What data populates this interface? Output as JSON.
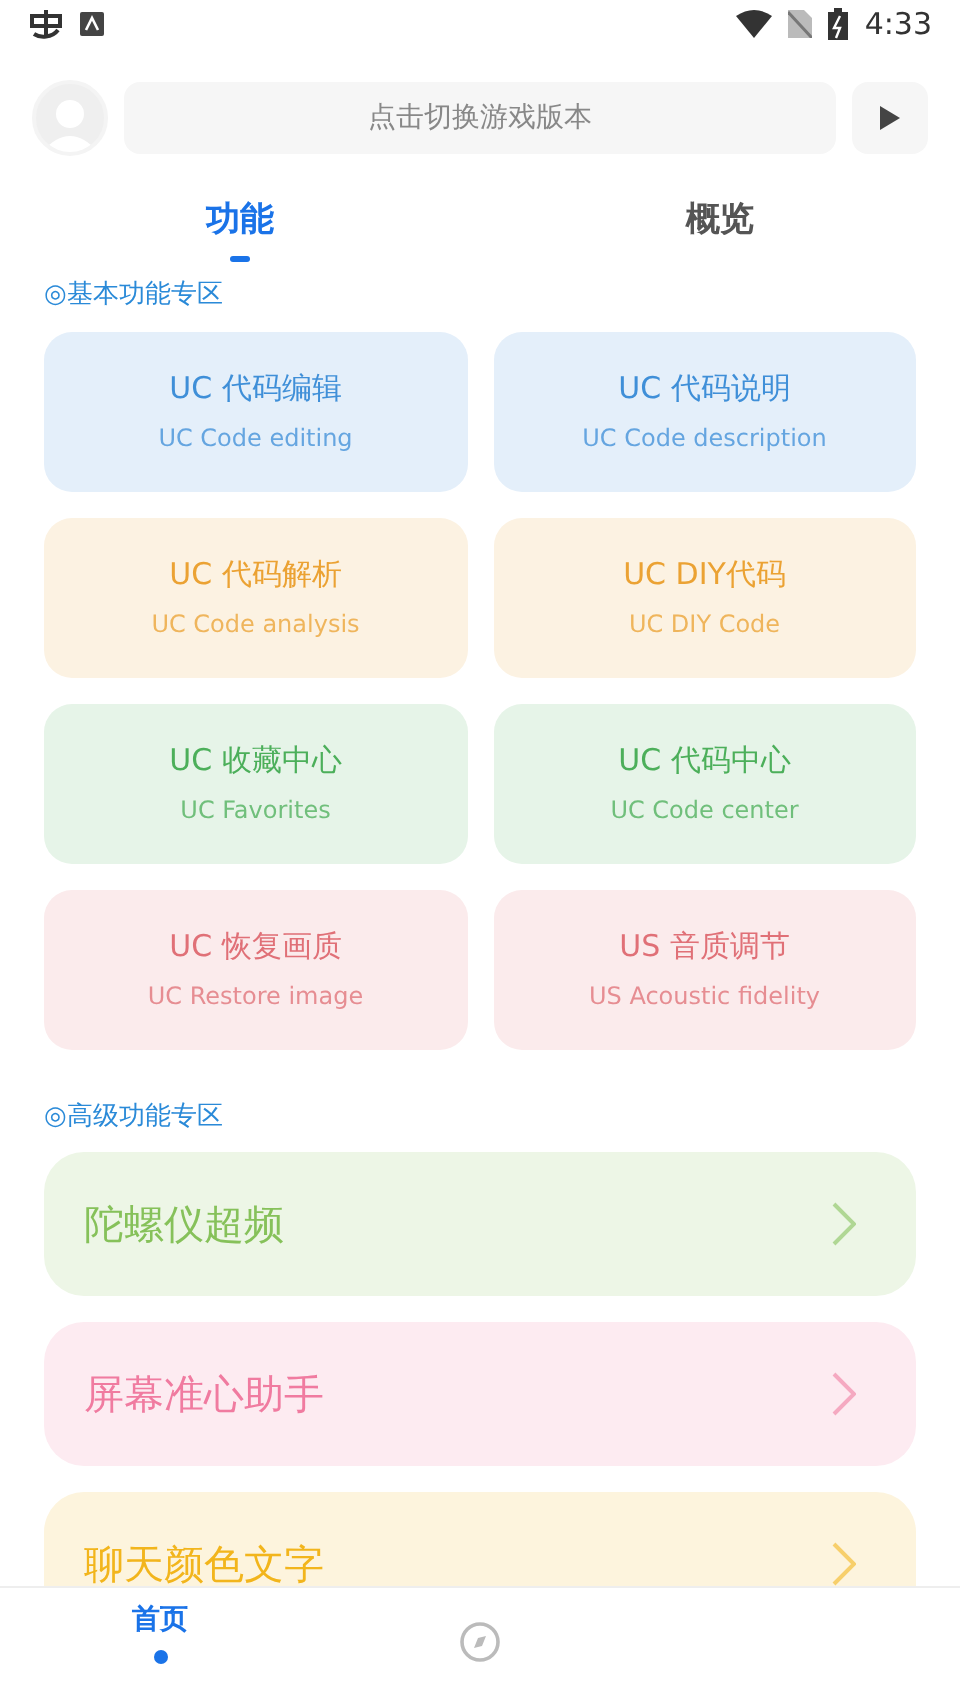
{
  "status_bar": {
    "time": "4:33"
  },
  "header": {
    "version_field": {
      "placeholder": "点击切换游戏版本"
    }
  },
  "tabs": [
    {
      "label": "功能",
      "selected": true
    },
    {
      "label": "概览",
      "selected": false
    }
  ],
  "basic_section": {
    "title": "◎基本功能专区",
    "cards": [
      {
        "title": "UC 代码编辑",
        "subtitle": "UC Code editing",
        "color": "#3f8fd8"
      },
      {
        "title": "UC 代码说明",
        "subtitle": "UC Code description",
        "color": "#3f8fd8"
      },
      {
        "title": "UC 代码解析",
        "subtitle": "UC Code analysis",
        "color": "#eba233"
      },
      {
        "title": "UC DIY代码",
        "subtitle": "UC DIY Code",
        "color": "#eba233"
      },
      {
        "title": "UC 收藏中心",
        "subtitle": "UC Favorites",
        "color": "#4caf5a"
      },
      {
        "title": "UC 代码中心",
        "subtitle": "UC Code center",
        "color": "#4caf5a"
      },
      {
        "title": "UC 恢复画质",
        "subtitle": "UC Restore image",
        "color": "#e07077"
      },
      {
        "title": "US 音质调节",
        "subtitle": "US Acoustic fidelity",
        "color": "#e07077"
      }
    ]
  },
  "advanced_section": {
    "title": "◎高级功能专区",
    "items": [
      {
        "label": "陀螺仪超频",
        "color": "#86c15a"
      },
      {
        "label": "屏幕准心助手",
        "color": "#f07ba0"
      },
      {
        "label": "聊天颜色文字",
        "color": "#f2b51c"
      }
    ]
  },
  "bottom_nav": [
    {
      "kind": "text",
      "label": "首页",
      "selected": true
    },
    {
      "kind": "icon",
      "selected": false
    }
  ]
}
